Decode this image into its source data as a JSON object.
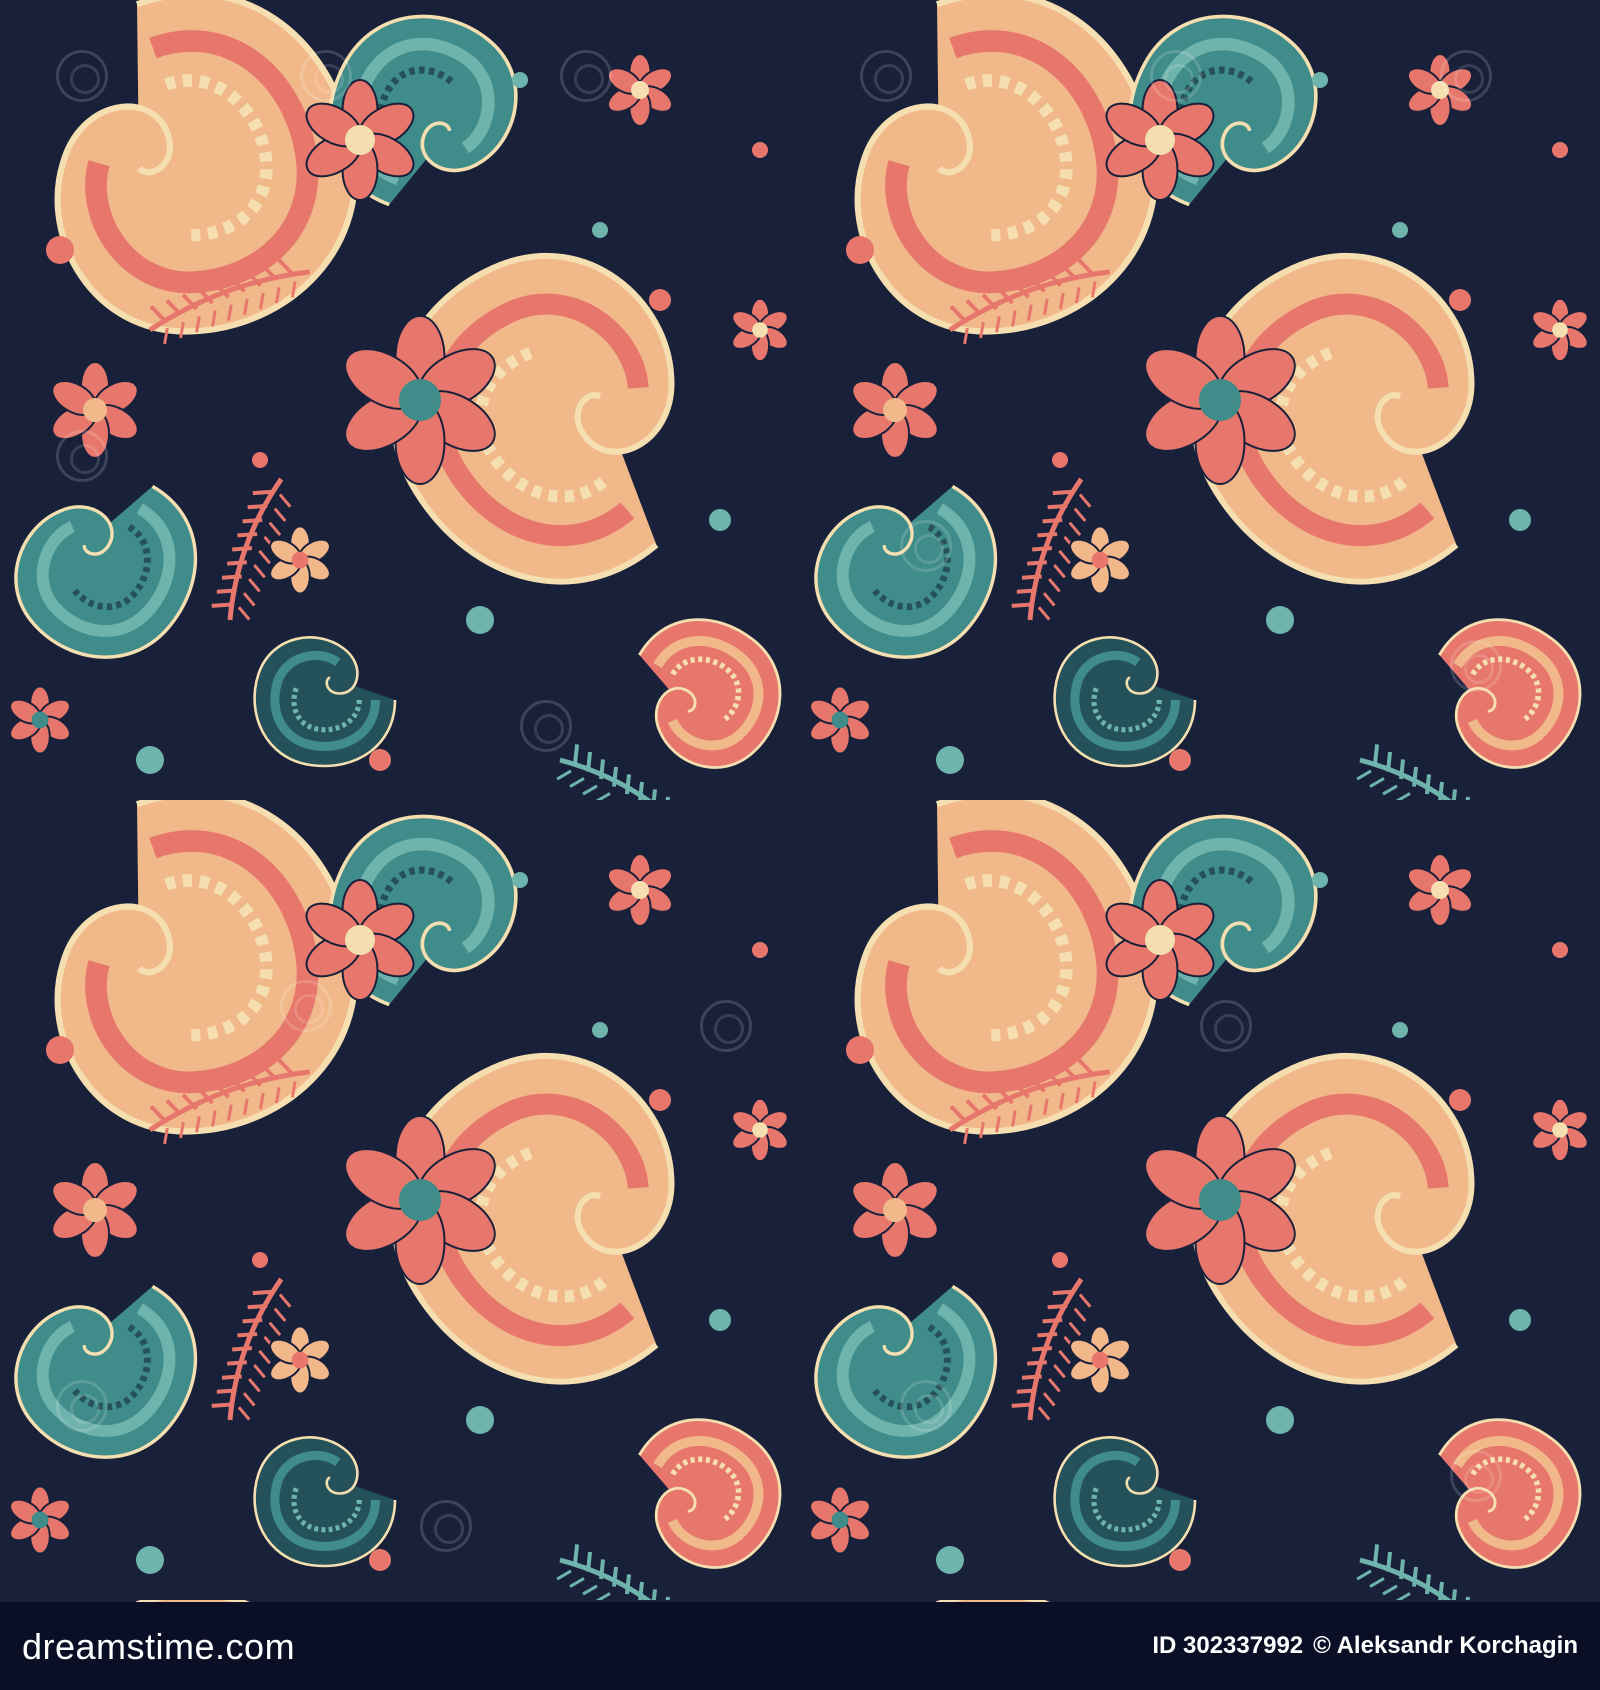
{
  "image": {
    "subject": "seamless-paisley-pattern",
    "colors": {
      "background": "#18203a",
      "teal": "#3f8c8a",
      "teal_light": "#6fb3ad",
      "coral": "#e7776c",
      "peach": "#f1b98a",
      "cream": "#f5dfb0",
      "dark_teal": "#24515a"
    }
  },
  "footer": {
    "logo_text": "dreamstime.com",
    "id_label": "ID 302337992",
    "copyright": "© Aleksandr Korchagin",
    "background": "#0b0f26"
  }
}
